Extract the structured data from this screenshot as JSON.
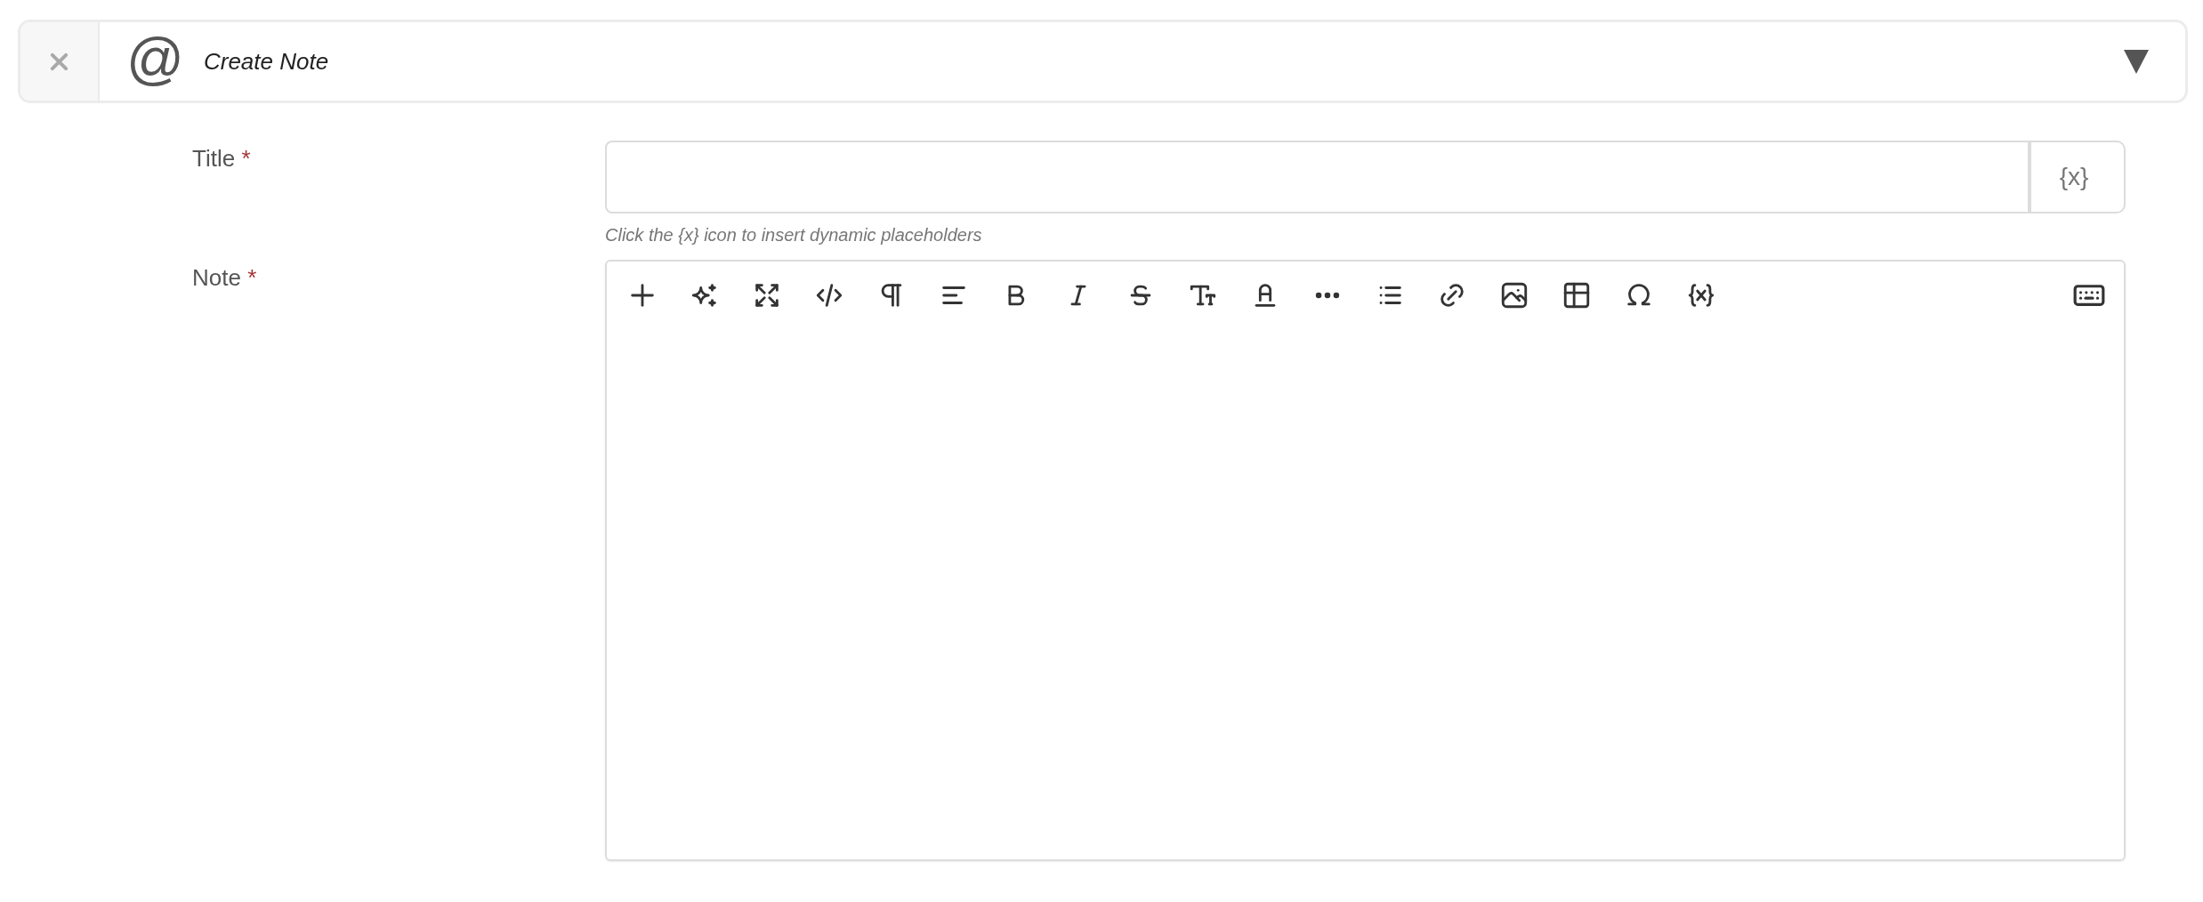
{
  "header": {
    "icon_glyph": "@",
    "title": "Create Note"
  },
  "fields": [
    {
      "kind": "text",
      "label": "Title",
      "required_mark": "*",
      "button": "{x}",
      "hint": "Click the {x} icon to insert dynamic placeholders"
    },
    {
      "kind": "editor",
      "label": "Note",
      "required_mark": "*"
    }
  ]
}
